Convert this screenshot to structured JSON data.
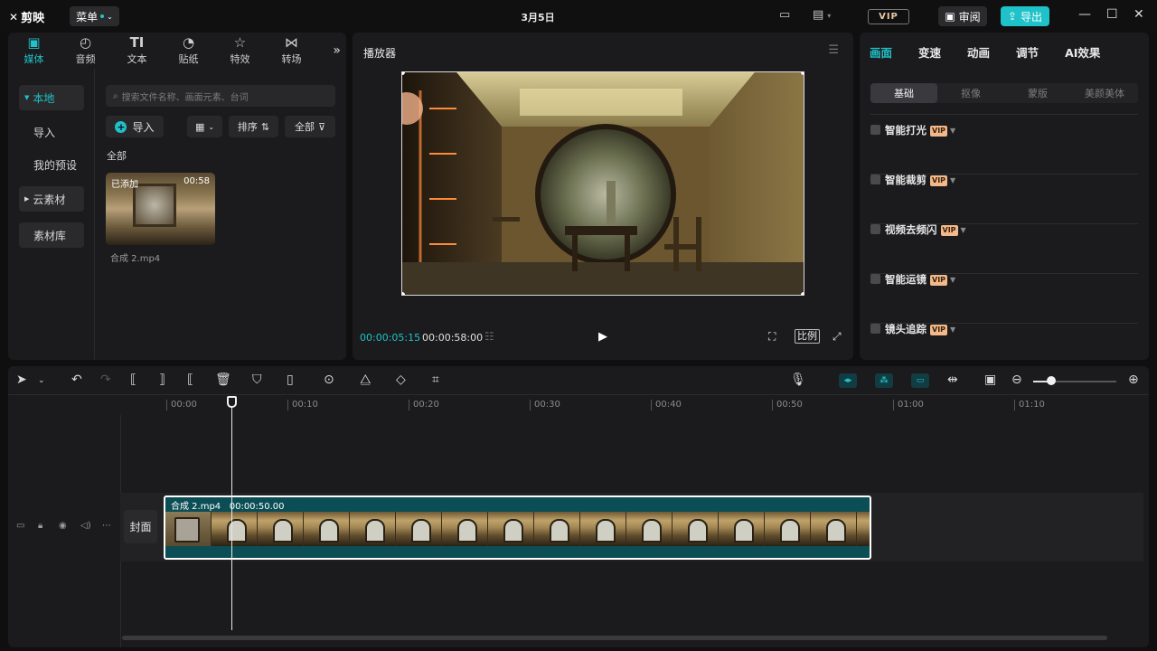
{
  "titlebar": {
    "app_name": "剪映",
    "menu_label": "菜单",
    "title": "3月5日",
    "vip_label": "VIP",
    "review_label": "审阅",
    "export_label": "导出"
  },
  "media_panel": {
    "tabs": [
      {
        "label": "媒体",
        "icon": "media-icon"
      },
      {
        "label": "音频",
        "icon": "audio-icon"
      },
      {
        "label": "文本",
        "icon": "text-icon"
      },
      {
        "label": "贴纸",
        "icon": "sticker-icon"
      },
      {
        "label": "特效",
        "icon": "effects-icon"
      },
      {
        "label": "转场",
        "icon": "transition-icon"
      }
    ],
    "sidebar": {
      "local": "本地",
      "import": "导入",
      "presets": "我的预设",
      "cloud": "云素材",
      "library": "素材库"
    },
    "search_placeholder": "搜索文件名称、画面元素、台词",
    "import_label": "导入",
    "sort_label": "排序",
    "filter_label": "全部",
    "section_label": "全部",
    "item": {
      "badge": "已添加",
      "duration": "00:58",
      "name": "合成 2.mp4"
    }
  },
  "player": {
    "title": "播放器",
    "current_time": "00:00:05:15",
    "total_time": "00:00:58:00",
    "ratio_label": "比例"
  },
  "props_panel": {
    "tabs": [
      "画面",
      "变速",
      "动画",
      "调节",
      "AI效果"
    ],
    "sub_tabs": [
      "基础",
      "抠像",
      "蒙版",
      "美颜美体"
    ],
    "rows": [
      {
        "label": "智能打光",
        "vip": "VIP"
      },
      {
        "label": "智能裁剪",
        "vip": "VIP"
      },
      {
        "label": "视频去频闪",
        "vip": "VIP"
      },
      {
        "label": "智能运镜",
        "vip": "VIP"
      },
      {
        "label": "镜头追踪",
        "vip": "VIP"
      }
    ]
  },
  "timeline": {
    "ruler": [
      "00:00",
      "00:10",
      "00:20",
      "00:30",
      "00:40",
      "00:50",
      "01:00",
      "01:10"
    ],
    "cover_label": "封面",
    "clip": {
      "name": "合成 2.mp4",
      "duration": "00:00:50.00"
    }
  },
  "colors": {
    "accent": "#1fc2c9",
    "vip": "#f3b98a",
    "clip_bg": "#0b4e55"
  }
}
